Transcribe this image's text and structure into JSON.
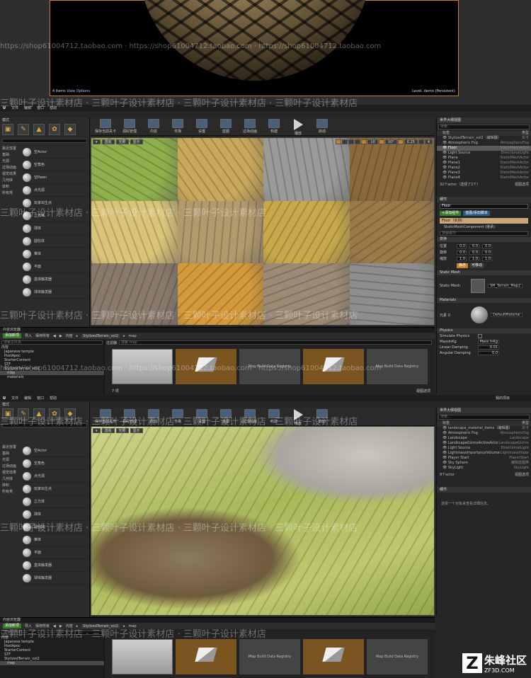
{
  "preview": {
    "items_label": "4 items",
    "view_options": "View Options",
    "level_label": "Level:",
    "level_name": "demo (Persistent)"
  },
  "watermark": {
    "shop_url": "https://shop61004712.taobao.com",
    "cn_text": "三颗叶子设计素材店"
  },
  "top_editor": {
    "menu": [
      "文件",
      "编辑",
      "窗口",
      "帮助"
    ],
    "tab_title": "",
    "modes_label": "模式",
    "categories": [
      "最近放置",
      "基础",
      "光源",
      "过场动画",
      "视觉效果",
      "几何体",
      "体积",
      "所有类"
    ],
    "placeables": [
      "空Actor",
      "空角色",
      "空Pawn",
      "点光源",
      "玩家出生点",
      "立方体",
      "球体",
      "圆柱体",
      "锥体",
      "平面",
      "盒体触发器",
      "球体触发器"
    ],
    "toolbar": [
      "保存当前关卡",
      "源码管理",
      "内容",
      "市场",
      "设置",
      "蓝图",
      "过场动画",
      "构建",
      "播放",
      "启动"
    ],
    "viewport_buttons": [
      "透视",
      "光照",
      "显示"
    ],
    "viewport_snap": [
      "10",
      "10°",
      "0.25",
      "4"
    ],
    "outliner": {
      "header": "世界大纲视图",
      "search_placeholder": "搜索...",
      "col_label": "标签",
      "col_type": "类型",
      "rows": [
        {
          "label": "StylizedTerrain_vol2（编辑器）",
          "type": "关卡",
          "sel": false
        },
        {
          "label": "Atmospheric Fog",
          "type": "AtmosphericFog",
          "sel": false
        },
        {
          "label": "Floor",
          "type": "StaticMeshActor",
          "sel": true
        },
        {
          "label": "Light Source",
          "type": "DirectionalLight",
          "sel": false
        },
        {
          "label": "Plane",
          "type": "StaticMeshActor",
          "sel": false
        },
        {
          "label": "Plane1",
          "type": "StaticMeshActor",
          "sel": false
        },
        {
          "label": "Plane2",
          "type": "StaticMeshActor",
          "sel": false
        },
        {
          "label": "Plane3",
          "type": "StaticMeshActor",
          "sel": false
        },
        {
          "label": "Plane4",
          "type": "StaticMeshActor",
          "sel": false
        }
      ],
      "footer": "32个actor（选择了1个）",
      "view_options": "视图选项"
    },
    "details": {
      "header": "细节",
      "floor_field": "Floor",
      "add_component": "+添加组件",
      "blueprint": "蓝图/添加脚本",
      "component_root": "Floor（实例）",
      "component_child": "StaticMeshComponent (继承)",
      "search_placeholder": "搜索细节",
      "transform_label": "变换",
      "location_label": "位置",
      "rotation_label": "旋转",
      "scale_label": "缩放",
      "location": [
        "0.0",
        "0.0",
        "0.0"
      ],
      "rotation": [
        "0.0",
        "0.0",
        "0.0"
      ],
      "scale": [
        "1.0",
        "1.0",
        "1.0"
      ],
      "mobility": "静态",
      "mobility2": "可移动",
      "static_mesh_sec": "Static Mesh",
      "static_mesh_label": "Static Mesh",
      "static_mesh_value": "SM_Terrain_Map2",
      "materials_sec": "Materials",
      "element_label": "元素 0",
      "material_value": "DefaultMaterial",
      "physics_sec": "Physics",
      "simulate_label": "Simulate Physics",
      "mass_label": "MassInKg",
      "mass_value": "Mass InKg",
      "linear_label": "Linear Damping",
      "linear_value": "0.01",
      "angular_label": "Angular Damping",
      "angular_value": "0.0"
    }
  },
  "content_browser": {
    "tab": "内容浏览器",
    "add_new": "添加新项",
    "import": "导入",
    "save_all": "保存所有",
    "path": [
      "内容",
      "StylizedTerrain_vol2",
      "map"
    ],
    "search_folders_placeholder": "搜索文件夹",
    "filters": "过滤器",
    "search_placeholder": "搜索 map",
    "tree": [
      "内容",
      "Japanese temple",
      "PostApoc",
      "StarterContent",
      "STF",
      "StylizedTerrain_vol2",
      "map",
      "materials"
    ],
    "asset_label": "Map Build Data Registry",
    "count": "7 项",
    "view_options": "视图选项"
  },
  "bottom_editor": {
    "outliner_rows": [
      {
        "label": "landscape_material_demo（编辑器）",
        "type": "关卡",
        "sel": false
      },
      {
        "label": "Atmospheric Fog",
        "type": "AtmosphericFog",
        "sel": false
      },
      {
        "label": "Landscape",
        "type": "Landscape",
        "sel": false
      },
      {
        "label": "LandscapeGizmoActiveActor",
        "type": "LandscapeGizmo",
        "sel": false
      },
      {
        "label": "Light Source",
        "type": "DirectionalLight",
        "sel": false
      },
      {
        "label": "LightmassImportanceVolume",
        "type": "LightmassImpor",
        "sel": false
      },
      {
        "label": "Player Start",
        "type": "PlayerStart",
        "sel": false
      },
      {
        "label": "Sky Sphere",
        "type": "编辑蓝图类",
        "sel": false
      },
      {
        "label": "SkyLight",
        "type": "SkyLight",
        "sel": false
      }
    ],
    "footer": "9个actor",
    "details_empty": "选择一个对象来查看详细信息。",
    "my_project": "我的项目"
  },
  "bottom_logo": {
    "cn": "朱峰社区",
    "url": "ZF3D.COM"
  }
}
